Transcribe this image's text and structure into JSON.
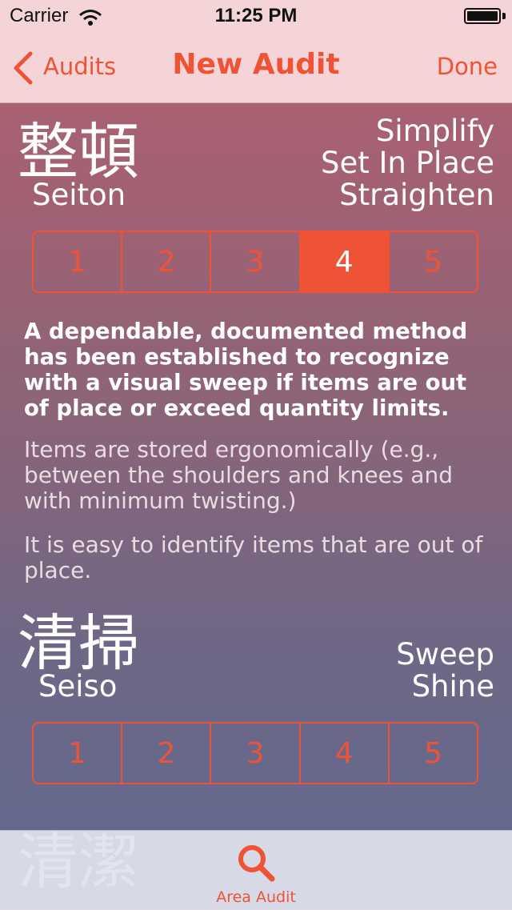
{
  "status_bar": {
    "carrier": "Carrier",
    "time": "11:25 PM"
  },
  "nav": {
    "back_label": "Audits",
    "title": "New Audit",
    "done_label": "Done"
  },
  "sections": [
    {
      "kanji": "整頓",
      "romaji": "Seiton",
      "meanings": [
        "Simplify",
        "Set In Place",
        "Straighten"
      ],
      "ratings": [
        "1",
        "2",
        "3",
        "4",
        "5"
      ],
      "selected_rating": 4,
      "description": "A dependable, documented method has been established to recognize with a visual sweep if items are out of place or exceed quantity limits.",
      "notes": [
        "Items are stored ergonomically (e.g., between the shoulders and knees and with minimum twisting.)",
        "It is easy to identify items that are out of place."
      ]
    },
    {
      "kanji": "清掃",
      "romaji": "Seiso",
      "meanings": [
        "Sweep",
        "Shine"
      ],
      "ratings": [
        "1",
        "2",
        "3",
        "4",
        "5"
      ],
      "selected_rating": null
    },
    {
      "kanji": "清潔"
    }
  ],
  "tab_bar": {
    "items": [
      {
        "label": "Area Audit",
        "icon": "search-icon"
      }
    ]
  },
  "colors": {
    "accent": "#ef5336",
    "nav_background": "#f4d4d6"
  }
}
